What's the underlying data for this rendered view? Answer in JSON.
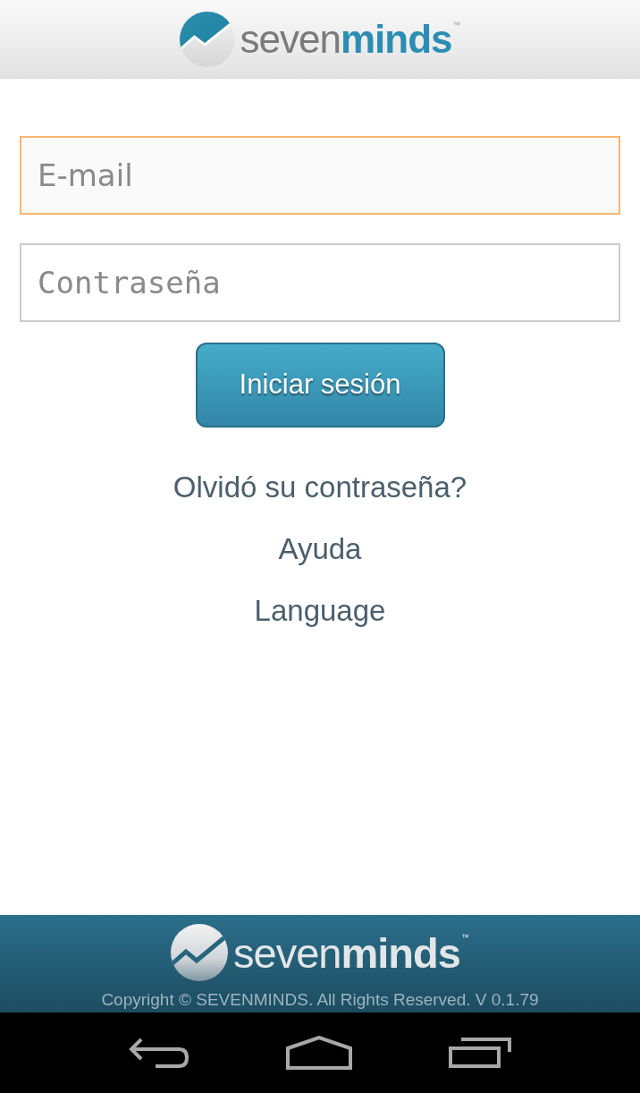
{
  "header": {
    "logo": {
      "light": "seven",
      "bold": "minds",
      "trademark": "™"
    }
  },
  "fields": [
    {
      "kind": "email",
      "placeholder": "E-mail",
      "focused": true
    },
    {
      "kind": "password",
      "placeholder": "Contraseña",
      "focused": false
    }
  ],
  "login_button": "Iniciar sesión",
  "links": [
    "Olvidó su contraseña?",
    "Ayuda",
    "Language"
  ],
  "footer": {
    "logo": {
      "light": "seven",
      "bold": "minds",
      "trademark": "™"
    },
    "copyright": "Copyright © SEVENMINDS. All Rights Reserved. V 0.1.79"
  }
}
